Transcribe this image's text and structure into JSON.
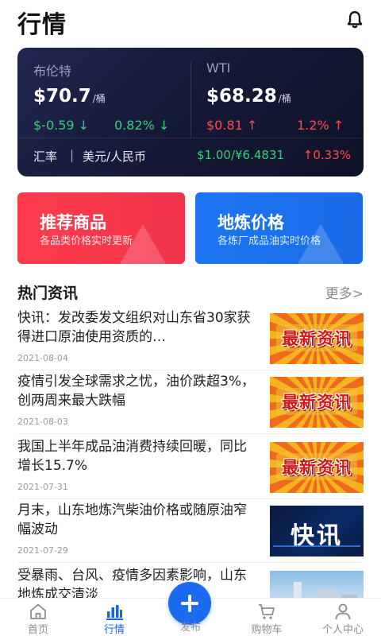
{
  "header": {
    "title": "行情",
    "bell_icon": "bell-icon"
  },
  "market": {
    "brent": {
      "name": "布伦特",
      "price": "$70.7",
      "unit": "/桶",
      "change": "$-0.59 ↓",
      "change_pct": "0.82% ↓"
    },
    "wti": {
      "name": "WTI",
      "price": "$68.28",
      "unit": "/桶",
      "change": "$0.81 ↑",
      "change_pct": "1.2% ↑"
    },
    "fx": {
      "label": "汇率",
      "separator": "|",
      "pair": "美元/人民币",
      "rate": "$1.00/¥6.4831",
      "change_pct": "↑0.33%"
    },
    "colors": {
      "down": "#2fd07a",
      "up": "#ff4a4a"
    }
  },
  "promos": [
    {
      "title": "推荐商品",
      "subtitle": "各品类价格实时更新",
      "color": "#f0344a"
    },
    {
      "title": "地炼价格",
      "subtitle": "各炼厂成品油实时价格",
      "color": "#1a6be8"
    }
  ],
  "news": {
    "title": "热门资讯",
    "more": "更多>",
    "items": [
      {
        "text": "快讯：发改委发文组织对山东省30家获得进口原油使用资质的…",
        "date": "2021-08-04",
        "thumb_text": "最新资讯"
      },
      {
        "text": "疫情引发全球需求之忧，油价跌超3%，创两周来最大跌幅",
        "date": "2021-08-03",
        "thumb_text": "最新资讯"
      },
      {
        "text": "我国上半年成品油消费持续回暖，同比增长15.7%",
        "date": "2021-07-31",
        "thumb_text": "最新资讯"
      },
      {
        "text": "月末，山东地炼汽柴油价格或随原油窄幅波动",
        "date": "2021-07-29",
        "thumb_text": "快讯"
      },
      {
        "text": "受暴雨、台风、疫情多因素影响，山东地炼成交清淡",
        "date": "",
        "thumb_text": ""
      }
    ]
  },
  "tabbar": {
    "items": [
      {
        "label": "首页",
        "icon": "home-icon"
      },
      {
        "label": "行情",
        "icon": "chart-icon"
      },
      {
        "label": "发布",
        "icon": "plus-icon"
      },
      {
        "label": "购物车",
        "icon": "cart-icon"
      },
      {
        "label": "个人中心",
        "icon": "user-icon"
      }
    ],
    "active_color": "#1b63e6"
  }
}
